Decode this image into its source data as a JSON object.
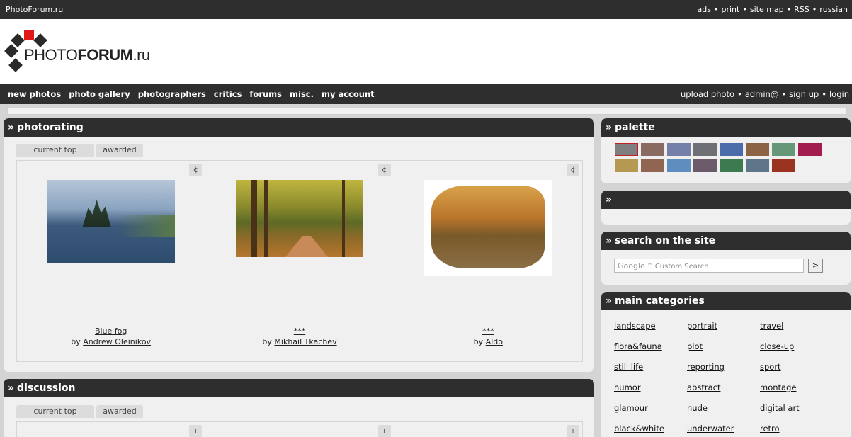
{
  "topbar": {
    "site": "PhotoForum.ru",
    "links": [
      "ads",
      "print",
      "site map",
      "RSS",
      "russian"
    ],
    "separator": "•"
  },
  "logo": {
    "bold": "PHOTO",
    "bold2": "FORUM",
    "suffix": ".ru"
  },
  "nav": {
    "left": [
      "new photos",
      "photo gallery",
      "photographers",
      "critics",
      "forums",
      "misc.",
      "my account"
    ],
    "right": [
      "upload photo",
      "admin@",
      "sign up",
      "login"
    ]
  },
  "panel_arrow": "»",
  "photorating": {
    "title": "photorating",
    "tabs": [
      "current top",
      "awarded"
    ],
    "button_glyph": "¢",
    "photos": [
      {
        "title": "Blue fog",
        "by": "by",
        "author": "Andrew Oleinikov"
      },
      {
        "title": "***",
        "by": "by",
        "author": "Mikhail Tkachev"
      },
      {
        "title": "***",
        "by": "by",
        "author": "Aldo"
      }
    ]
  },
  "discussion": {
    "title": "discussion",
    "tabs": [
      "current top",
      "awarded"
    ],
    "button_glyph": "+"
  },
  "palette": {
    "title": "palette",
    "colors": [
      "#7f7f7f",
      "#8a6b62",
      "#7480a8",
      "#6f7076",
      "#4a6ca8",
      "#8a6443",
      "#669779",
      "#a31c4f",
      "#b59851",
      "#906652",
      "#5e8ebd",
      "#6b5b6b",
      "#3c7a50",
      "#5f7589",
      "#9a3420"
    ]
  },
  "empty_panel": {
    "title": ""
  },
  "search": {
    "title": "search on the site",
    "google_mark": "Google™",
    "placeholder": "Custom Search",
    "button": ">"
  },
  "categories": {
    "title": "main categories",
    "items": [
      "landscape",
      "portrait",
      "travel",
      "flora&fauna",
      "plot",
      "close-up",
      "still life",
      "reporting",
      "sport",
      "humor",
      "abstract",
      "montage",
      "glamour",
      "nude",
      "digital art",
      "black&white",
      "underwater",
      "retro"
    ]
  }
}
